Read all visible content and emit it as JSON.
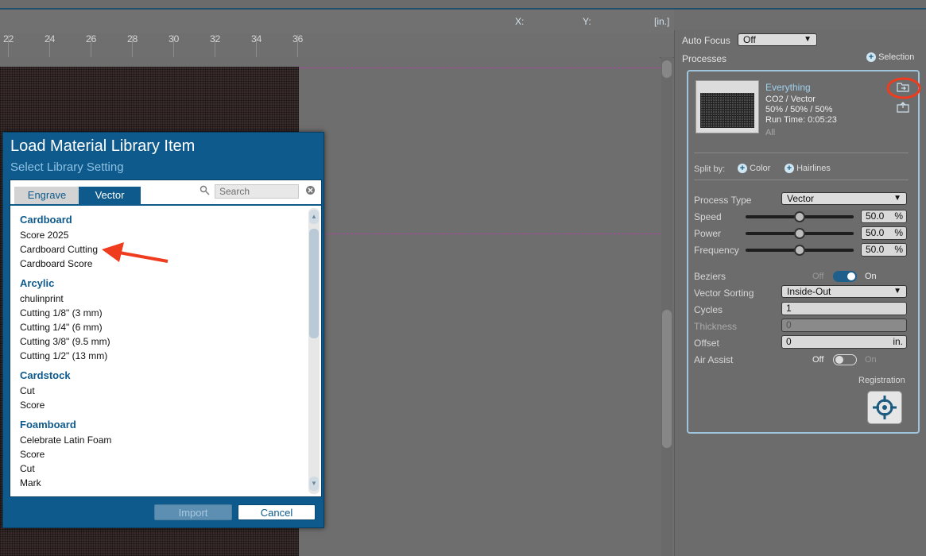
{
  "coords": {
    "x_label": "X:",
    "y_label": "Y:",
    "unit": "[in.]"
  },
  "ruler": {
    "labels": [
      "22",
      "24",
      "26",
      "28",
      "30",
      "32",
      "34",
      "36"
    ]
  },
  "right_panel": {
    "auto_focus_label": "Auto Focus",
    "auto_focus_value": "Off",
    "processes_label": "Processes",
    "selection_label": "Selection",
    "process": {
      "name": "Everything",
      "type": "CO2 / Vector",
      "settings": "50% / 50% / 50%",
      "run_time": "Run Time: 0:05:23",
      "scope": "All"
    },
    "split_by_label": "Split by:",
    "split_color": "Color",
    "split_hairlines": "Hairlines",
    "process_type_label": "Process Type",
    "process_type_value": "Vector",
    "speed_label": "Speed",
    "speed_value": "50.0",
    "power_label": "Power",
    "power_value": "50.0",
    "frequency_label": "Frequency",
    "frequency_value": "50.0",
    "percent": "%",
    "speed_level": 0.5,
    "power_level": 0.5,
    "frequency_level": 0.5,
    "beziers_label": "Beziers",
    "off": "Off",
    "on": "On",
    "vector_sorting_label": "Vector Sorting",
    "vector_sorting_value": "Inside-Out",
    "cycles_label": "Cycles",
    "cycles_value": "1",
    "thickness_label": "Thickness",
    "thickness_value": "0",
    "offset_label": "Offset",
    "offset_value": "0",
    "offset_unit": "in.",
    "air_assist_label": "Air Assist",
    "registration_label": "Registration"
  },
  "dialog": {
    "title": "Load Material Library Item",
    "subtitle": "Select Library Setting",
    "tabs": [
      "Engrave",
      "Vector"
    ],
    "search_placeholder": "Search",
    "categories": [
      {
        "name": "Cardboard",
        "items": [
          "Score 2025",
          "Cardboard Cutting",
          "Cardboard Score"
        ]
      },
      {
        "name": "Arcylic",
        "items": [
          "chulinprint",
          "Cutting 1/8\" (3 mm)",
          "Cutting 1/4\" (6 mm)",
          "Cutting 3/8\" (9.5 mm)",
          "Cutting 1/2\" (13 mm)"
        ]
      },
      {
        "name": "Cardstock",
        "items": [
          "Cut",
          "Score"
        ]
      },
      {
        "name": "Foamboard",
        "items": [
          "Celebrate Latin Foam",
          "Score",
          "Cut",
          "Mark"
        ]
      }
    ],
    "import_label": "Import",
    "cancel_label": "Cancel"
  },
  "colors": {
    "accent": "#0e5a8c",
    "annotation": "#f03c1e"
  }
}
